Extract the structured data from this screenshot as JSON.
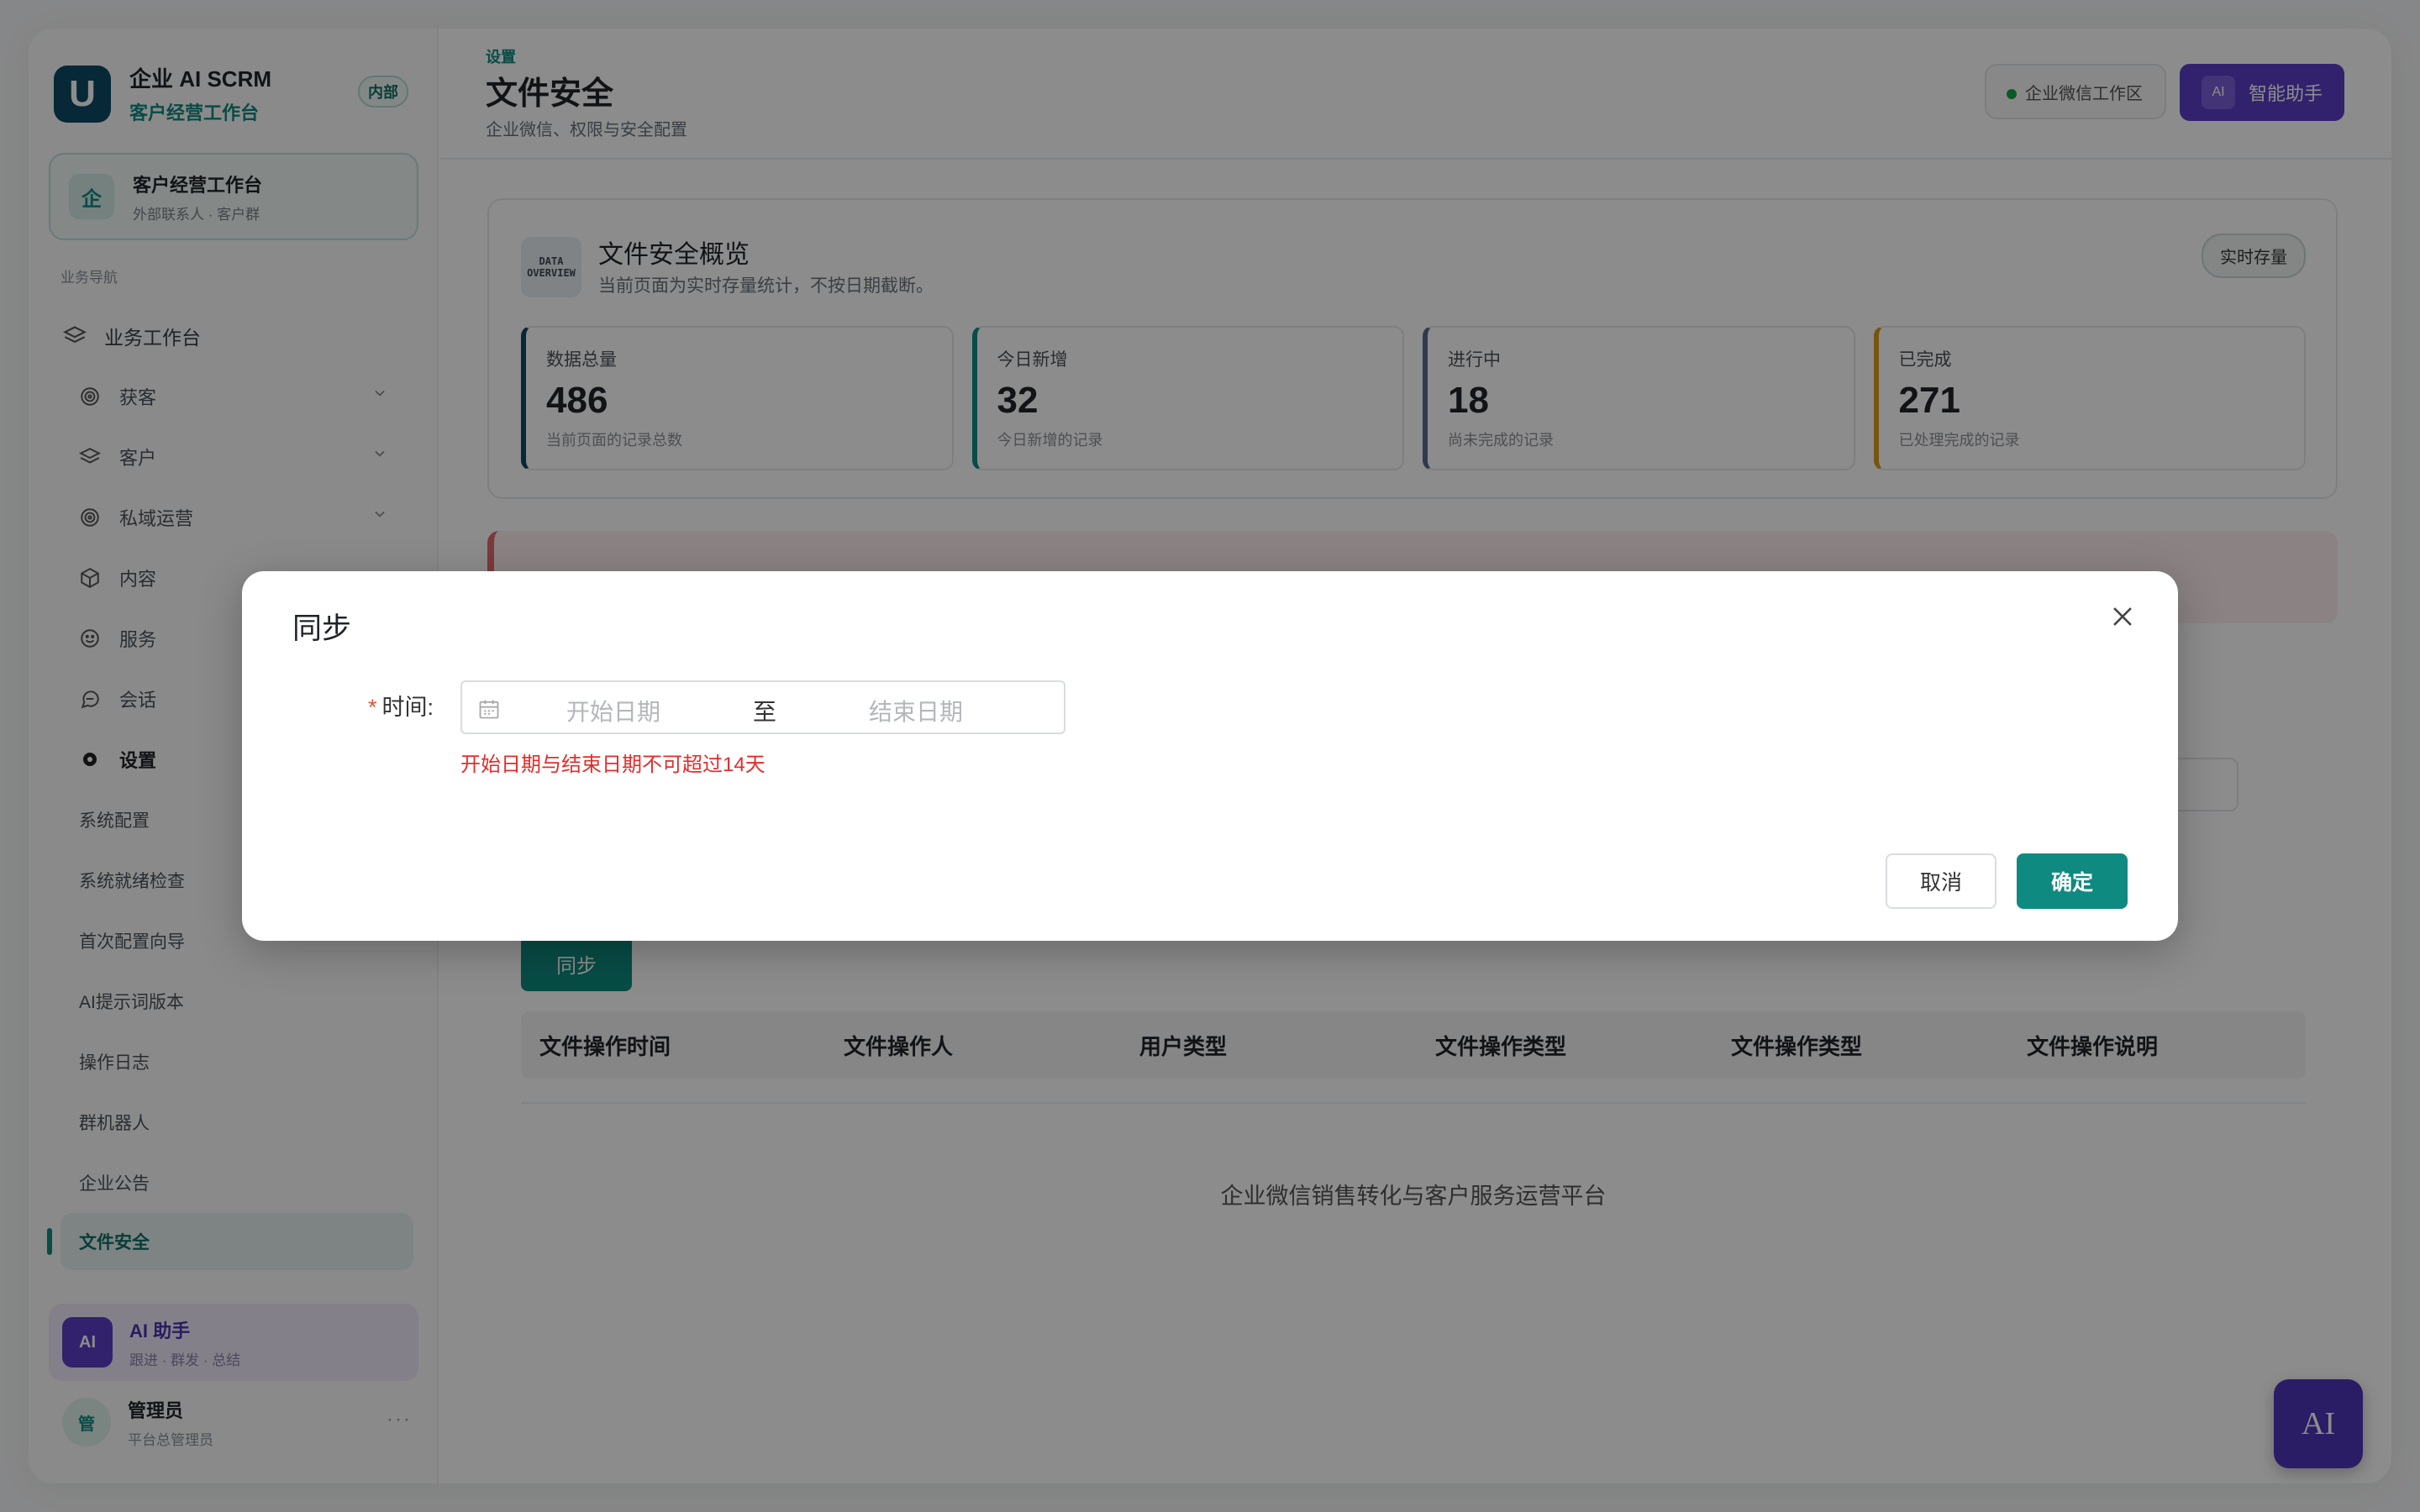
{
  "brand": {
    "title": "企业 AI SCRM",
    "subtitle": "客户经营工作台",
    "badge": "内部",
    "logo_letter": "U"
  },
  "workspace": {
    "icon_text": "企",
    "title": "客户经营工作台",
    "subtitle": "外部联系人 · 客户群"
  },
  "sidebar": {
    "section_label": "业务导航",
    "top_item": "业务工作台",
    "items": [
      {
        "label": "获客",
        "icon": "target-icon",
        "expandable": true
      },
      {
        "label": "客户",
        "icon": "layers-icon",
        "expandable": true
      },
      {
        "label": "私域运营",
        "icon": "target-icon",
        "expandable": true
      },
      {
        "label": "内容",
        "icon": "cube-icon",
        "expandable": false
      },
      {
        "label": "服务",
        "icon": "service-icon",
        "expandable": false
      },
      {
        "label": "会话",
        "icon": "chat-icon",
        "expandable": false
      },
      {
        "label": "设置",
        "icon": "settings-icon",
        "expandable": false
      }
    ],
    "sub_items": [
      "系统配置",
      "系统就绪检查",
      "首次配置向导",
      "AI提示词版本",
      "操作日志",
      "群机器人",
      "企业公告",
      "文件安全"
    ],
    "selected": "文件安全"
  },
  "ai_card": {
    "icon_text": "AI",
    "title": "AI 助手",
    "subtitle": "跟进 · 群发 · 总结"
  },
  "user": {
    "avatar_text": "管",
    "name": "管理员",
    "role": "平台总管理员",
    "more": "···"
  },
  "header": {
    "breadcrumb": "设置",
    "title": "文件安全",
    "subtitle": "企业微信、权限与安全配置",
    "workspace_pill": "企业微信工作区",
    "assistant_icon": "AI",
    "assistant_label": "智能助手"
  },
  "overview": {
    "icon_lines": [
      "DATA",
      "OVERVIEW"
    ],
    "title": "文件安全概览",
    "subtitle": "当前页面为实时存量统计，不按日期截断。",
    "badge": "实时存量",
    "stats": [
      {
        "label": "数据总量",
        "value": "486",
        "desc": "当前页面的记录总数",
        "color": "#0e4a63"
      },
      {
        "label": "今日新增",
        "value": "32",
        "desc": "今日新增的记录",
        "color": "#0f8a80"
      },
      {
        "label": "进行中",
        "value": "18",
        "desc": "尚未完成的记录",
        "color": "#5a6b8a"
      },
      {
        "label": "已完成",
        "value": "271",
        "desc": "已处理完成的记录",
        "color": "#d99a1e"
      }
    ]
  },
  "actions": {
    "sync_label": "同步"
  },
  "table": {
    "columns": [
      "文件操作时间",
      "文件操作人",
      "用户类型",
      "文件操作类型",
      "文件操作类型",
      "文件操作说明"
    ],
    "empty_text": "企业微信销售转化与客户服务运营平台"
  },
  "fab": {
    "label": "AI"
  },
  "modal": {
    "title": "同步",
    "field_required_mark": "*",
    "field_label": "时间:",
    "start_placeholder": "开始日期",
    "separator": "至",
    "end_placeholder": "结束日期",
    "error": "开始日期与结束日期不可超过14天",
    "cancel_label": "取消",
    "ok_label": "确定"
  },
  "colors": {
    "primary": "#0f8a80",
    "brand_dark": "#0e4a63",
    "ai_purple": "#5b3ec6",
    "error": "#e52c2c"
  }
}
